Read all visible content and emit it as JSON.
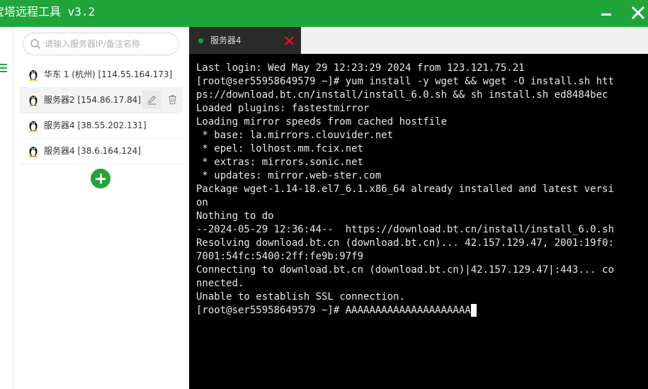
{
  "app": {
    "title": "宝塔远程工具 v3.2",
    "accent_color": "#20a53a",
    "controls": {
      "minimize_icon": "minimize-icon",
      "close_icon": "close-icon"
    }
  },
  "sidebar": {
    "search": {
      "placeholder": "请输入服务器IP/备注名称",
      "value": ""
    },
    "servers": [
      {
        "label": "华东 1 (杭州) [114.55.164.173]",
        "icon": "linux-penguin-icon",
        "active": false
      },
      {
        "label": "服务器2 [154.86.17.84]",
        "icon": "linux-penguin-icon",
        "active": true
      },
      {
        "label": "服务器4 [38.55.202.131]",
        "icon": "linux-penguin-icon",
        "active": false
      },
      {
        "label": "服务器4 [38.6.164.124]",
        "icon": "linux-penguin-icon",
        "active": false
      }
    ],
    "row_actions": [
      "edit-icon",
      "trash-icon"
    ],
    "add_icon": "plus-icon"
  },
  "tabs": [
    {
      "label": "服务器4",
      "status_color": "#20a53a",
      "close_color": "#e81123"
    }
  ],
  "terminal": {
    "lines": [
      "Last login: Wed May 29 12:23:29 2024 from 123.121.75.21",
      "[root@ser55958649579 ~]# yum install -y wget && wget -O install.sh htt",
      "ps://download.bt.cn/install/install_6.0.sh && sh install.sh ed8484bec",
      "Loaded plugins: fastestmirror",
      "Loading mirror speeds from cached hostfile",
      " * base: la.mirrors.clouvider.net",
      " * epel: lolhost.mm.fcix.net",
      " * extras: mirrors.sonic.net",
      " * updates: mirror.web-ster.com",
      "Package wget-1.14-18.el7_6.1.x86_64 already installed and latest versi",
      "on",
      "Nothing to do",
      "--2024-05-29 12:36:44--  https://download.bt.cn/install/install_6.0.sh",
      "Resolving download.bt.cn (download.bt.cn)... 42.157.129.47, 2001:19f0:",
      "7001:54fc:5400:2ff:fe9b:97f9",
      "Connecting to download.bt.cn (download.bt.cn)|42.157.129.47|:443... co",
      "nnected.",
      "Unable to establish SSL connection."
    ],
    "prompt": "[root@ser55958649579 ~]# ",
    "current_input": "AAAAAAAAAAAAAAAAAAAAA"
  }
}
